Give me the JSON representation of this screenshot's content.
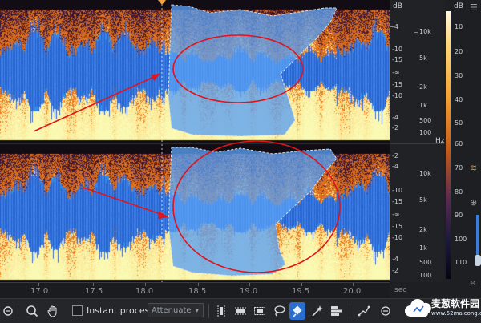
{
  "editor": {
    "time_labels": [
      "17.0",
      "17.5",
      "18.0",
      "18.5",
      "19.0",
      "19.5",
      "20.0"
    ],
    "time_unit": "sec"
  },
  "channel_ruler": {
    "db_unit": "dB",
    "hz_unit": "Hz",
    "db_ticks_top": [
      "-4",
      "-10",
      "-15",
      "-∞",
      "-15",
      "-10",
      "-4",
      "-2"
    ],
    "db_ticks_bottom": [
      "-2",
      "-4",
      "-10",
      "-15",
      "-∞",
      "-15",
      "-10",
      "-4",
      "-2"
    ],
    "hz_ticks_top": [
      "10k",
      "5k",
      "2k",
      "1k",
      "500",
      "100"
    ],
    "hz_ticks_bottom": [
      "10k",
      "5k",
      "2k",
      "1k",
      "500",
      "100"
    ]
  },
  "color_scale": {
    "unit": "dB",
    "ticks": [
      "10",
      "20",
      "30",
      "40",
      "50",
      "60",
      "70",
      "80",
      "90",
      "100",
      "110"
    ]
  },
  "toolbar": {
    "instant_process_label": "Instant process",
    "instant_process_checked": false,
    "mode_value": "Attenuate"
  },
  "watermark": {
    "brand": "麦葱软件园",
    "url": "www.52maicong.com"
  },
  "colors": {
    "waveform": "#3d8ff0",
    "selection": "#4f95ee",
    "annotation": "#e0141c",
    "accent": "#2a6fd0"
  }
}
